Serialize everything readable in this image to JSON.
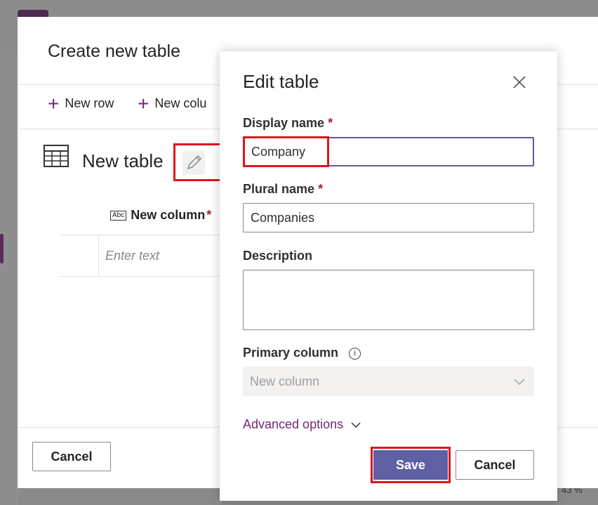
{
  "outer_dialog": {
    "title": "Create new table",
    "commands": {
      "new_row": "New row",
      "new_column": "New colu"
    },
    "table_name": "New table",
    "column_header": {
      "type_badge": "Abc",
      "label": "New column",
      "required": "*"
    },
    "cell_placeholder": "Enter text",
    "cancel_label": "Cancel"
  },
  "edit_panel": {
    "title": "Edit table",
    "display_name": {
      "label": "Display name",
      "required": "*",
      "value": "Company"
    },
    "plural_name": {
      "label": "Plural name",
      "required": "*",
      "value": "Companies"
    },
    "description": {
      "label": "Description",
      "value": ""
    },
    "primary_column": {
      "label": "Primary column",
      "info_icon": "i",
      "value": "New column"
    },
    "advanced_options": "Advanced options",
    "save_label": "Save",
    "cancel_label": "Cancel"
  },
  "background": {
    "zoom_text": "43 %"
  },
  "colors": {
    "accent_purple": "#742774",
    "save_button": "#5f5fa6",
    "highlight_red": "#e0141e"
  }
}
